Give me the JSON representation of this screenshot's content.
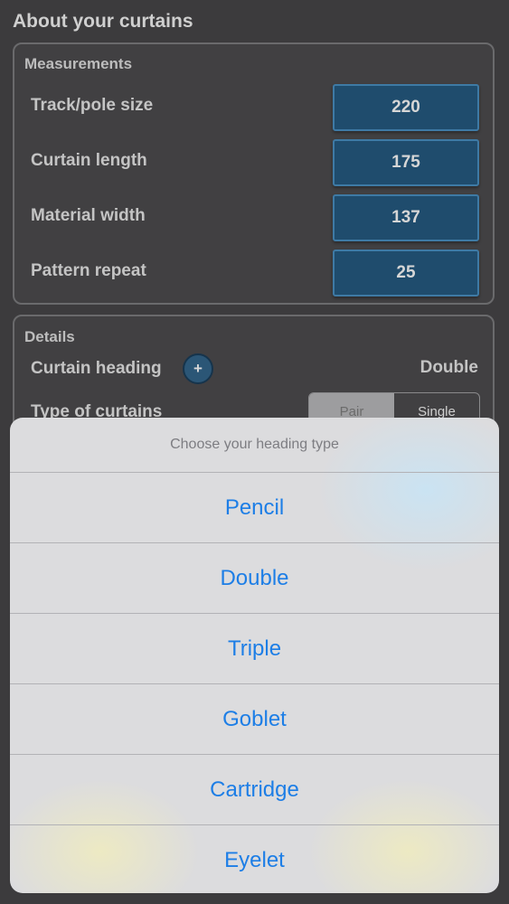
{
  "page": {
    "title": "About your curtains"
  },
  "measurements": {
    "title": "Measurements",
    "rows": [
      {
        "label": "Track/pole size",
        "value": "220"
      },
      {
        "label": "Curtain length",
        "value": "175"
      },
      {
        "label": "Material width",
        "value": "137"
      },
      {
        "label": "Pattern repeat",
        "value": "25"
      }
    ]
  },
  "details": {
    "title": "Details",
    "heading_label": "Curtain heading",
    "heading_add_symbol": "+",
    "heading_value": "Double",
    "type_label": "Type of curtains",
    "type_options": [
      "Pair",
      "Single"
    ],
    "type_selected": "Pair"
  },
  "sheet": {
    "title": "Choose your heading type",
    "options": [
      "Pencil",
      "Double",
      "Triple",
      "Goblet",
      "Cartridge",
      "Eyelet"
    ]
  },
  "colors": {
    "accent_blue": "#1d7ee6",
    "input_fill": "#1f4c6d",
    "background": "#3c3b3d"
  }
}
